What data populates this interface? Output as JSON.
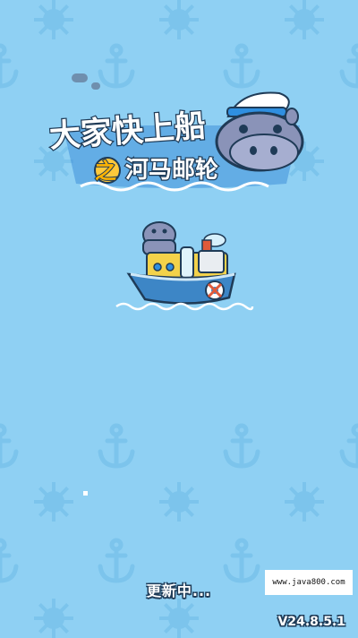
{
  "logo": {
    "title": "大家快上船",
    "connector": "之",
    "subtitle": "河马邮轮"
  },
  "loading": {
    "status": "更新中..."
  },
  "watermark": {
    "text": "www.java800.com"
  },
  "footer": {
    "version": "V24.8.5.1"
  },
  "colors": {
    "background": "#8fd0f3",
    "pattern": "#7cc4ec",
    "logo_blue": "#2f8fe0",
    "logo_dark": "#1f3b57",
    "hippo": "#8a93b8",
    "boat_hull": "#3d86c6",
    "boat_deck": "#f3d24a"
  }
}
